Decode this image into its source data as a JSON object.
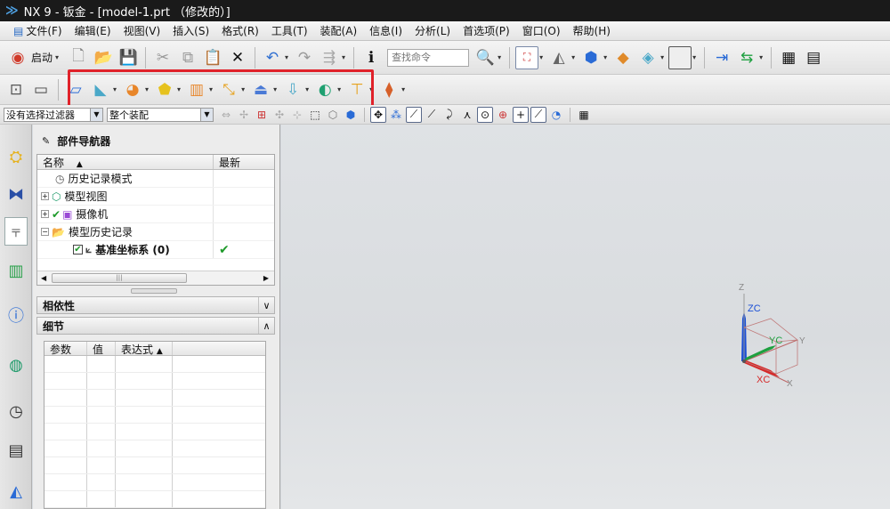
{
  "title": "NX 9 - 钣金 - [model-1.prt （修改的）]",
  "menu": [
    "文件(F)",
    "编辑(E)",
    "视图(V)",
    "插入(S)",
    "格式(R)",
    "工具(T)",
    "装配(A)",
    "信息(I)",
    "分析(L)",
    "首选项(P)",
    "窗口(O)",
    "帮助(H)"
  ],
  "toolbar": {
    "start_label": "启动",
    "search_placeholder": "查找命令"
  },
  "selection": {
    "filter": "没有选择过滤器",
    "scope": "整个装配"
  },
  "navigator": {
    "title": "部件导航器",
    "columns": [
      "名称",
      "最新"
    ],
    "items": [
      {
        "label": "历史记录模式",
        "latest": ""
      },
      {
        "label": "模型视图",
        "latest": ""
      },
      {
        "label": "摄像机",
        "latest": ""
      },
      {
        "label": "模型历史记录",
        "latest": ""
      },
      {
        "label": "基准坐标系 (0)",
        "latest": "✔"
      }
    ],
    "sections": {
      "dependencies": "相依性",
      "details": "细节"
    },
    "detail_columns": [
      "参数",
      "值",
      "表达式"
    ]
  },
  "triad": {
    "z": "Z",
    "zc": "ZC",
    "y": "Y",
    "yc": "YC",
    "x": "X",
    "xc": "XC"
  },
  "colors": {
    "highlight": "#e0222a",
    "check": "#1e9a2a",
    "z_axis": "#1a4fd6",
    "y_axis": "#1ea040",
    "x_axis": "#d62a2a"
  }
}
